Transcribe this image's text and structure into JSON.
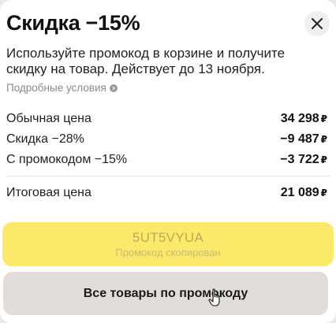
{
  "popup": {
    "title": "Скидка −15%",
    "description": "Используйте промокод в корзине и получите скидку на товар. Действует до 13 ноября.",
    "conditions_link": "Подробные условия",
    "currency": "₽",
    "rows": [
      {
        "label": "Обычная цена",
        "value": "34 298"
      },
      {
        "label": "Скидка −28%",
        "value": "−9 487"
      },
      {
        "label": "С промокодом −15%",
        "value": "−3 722"
      }
    ],
    "total": {
      "label": "Итоговая цена",
      "value": "21 089"
    },
    "promo": {
      "code": "5UT5VYUA",
      "status": "Промокод скопирован"
    },
    "all_products_button": "Все товары по промокоду"
  }
}
